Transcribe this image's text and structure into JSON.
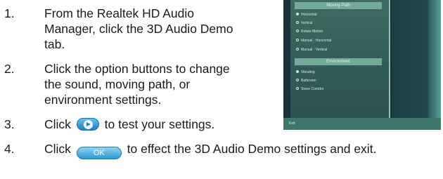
{
  "steps": [
    {
      "number": "1.",
      "text": "From the Realtek HD Audio Manager, click the 3D Audio Demo tab."
    },
    {
      "number": "2.",
      "text": "Click the option buttons to change the sound, moving path, or environment settings."
    },
    {
      "number": "3.",
      "before": "Click",
      "after": "to test your settings."
    },
    {
      "number": "4.",
      "before": "Click",
      "button_label": "OK",
      "after": "to effect the 3D Audio Demo settings and exit."
    }
  ],
  "screenshot": {
    "moving_path_title": "Moving Path",
    "moving_path_options": [
      "Horizontal",
      "Vertical",
      "Rotate Motion",
      "Manual - Horizontal",
      "Manual - Vertical"
    ],
    "environment_title": "Environment",
    "environment_options": [
      "Vibrating",
      "Bathroom",
      "Stone Corridor"
    ],
    "exit_label": "Exit"
  },
  "icons": {
    "play": "play-icon",
    "ok": "ok-button-icon"
  },
  "colors": {
    "button_blue": "#1f82c4",
    "panel_teal": "#3d6b62"
  }
}
